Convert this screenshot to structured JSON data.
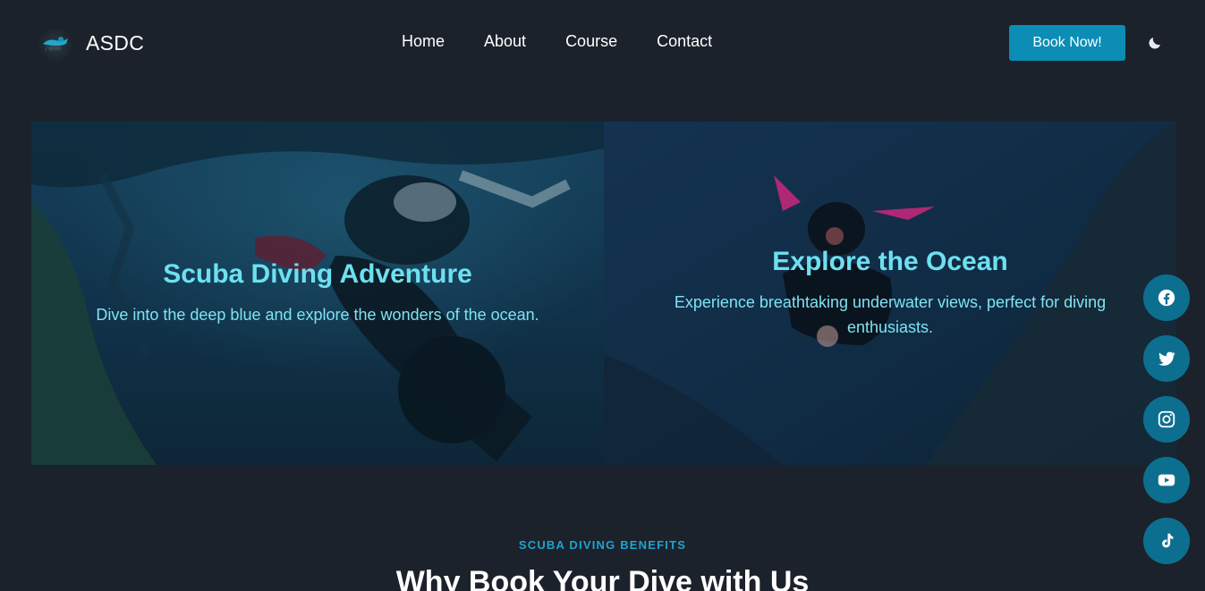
{
  "brand": {
    "name": "ASDC",
    "logo_icon": "scuba-diver-logo-icon"
  },
  "nav": {
    "links": [
      {
        "label": "Home"
      },
      {
        "label": "About"
      },
      {
        "label": "Course"
      },
      {
        "label": "Contact"
      }
    ],
    "cta_label": "Book Now!",
    "theme_icon": "moon-icon"
  },
  "hero": {
    "slides": [
      {
        "title": "Scuba Diving Adventure",
        "description": "Dive into the deep blue and explore the wonders of the ocean."
      },
      {
        "title": "Explore the Ocean",
        "description": "Experience breathtaking underwater views, perfect for diving enthusiasts."
      }
    ]
  },
  "social": [
    {
      "icon": "facebook-icon"
    },
    {
      "icon": "twitter-icon"
    },
    {
      "icon": "instagram-icon"
    },
    {
      "icon": "youtube-icon"
    },
    {
      "icon": "tiktok-icon"
    }
  ],
  "benefits": {
    "eyebrow": "SCUBA DIVING BENEFITS",
    "title": "Why Book Your Dive with Us"
  },
  "colors": {
    "background": "#1c222b",
    "accent": "#0b8db5",
    "hero_text": "#6ee0f0",
    "social_bg": "#0d6f8f"
  }
}
